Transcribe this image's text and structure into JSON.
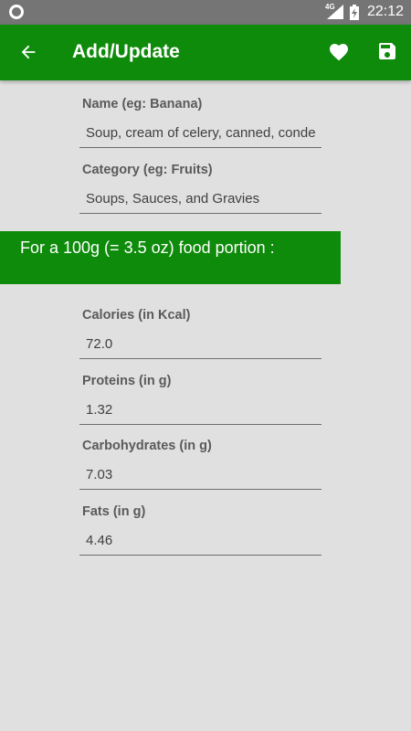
{
  "status_bar": {
    "network": "4G",
    "time": "22:12"
  },
  "app_bar": {
    "title": "Add/Update"
  },
  "form": {
    "name": {
      "label": "Name (eg: Banana)",
      "value": "Soup, cream of celery, canned, conde"
    },
    "category": {
      "label": "Category (eg: Fruits)",
      "value": "Soups, Sauces, and Gravies"
    },
    "portion_banner": "For a 100g (= 3.5 oz) food portion :",
    "calories": {
      "label": "Calories (in Kcal)",
      "value": "72.0"
    },
    "proteins": {
      "label": "Proteins (in g)",
      "value": "1.32"
    },
    "carbohydrates": {
      "label": "Carbohydrates (in g)",
      "value": "7.03"
    },
    "fats": {
      "label": "Fats (in g)",
      "value": "4.46"
    }
  },
  "icons": {
    "back": "arrow-back-icon",
    "favorite": "heart-icon",
    "save": "floppy-disk-icon"
  },
  "colors": {
    "accent": "#0f8b0b",
    "background": "#e0e0e0",
    "status_bar": "#757575"
  }
}
